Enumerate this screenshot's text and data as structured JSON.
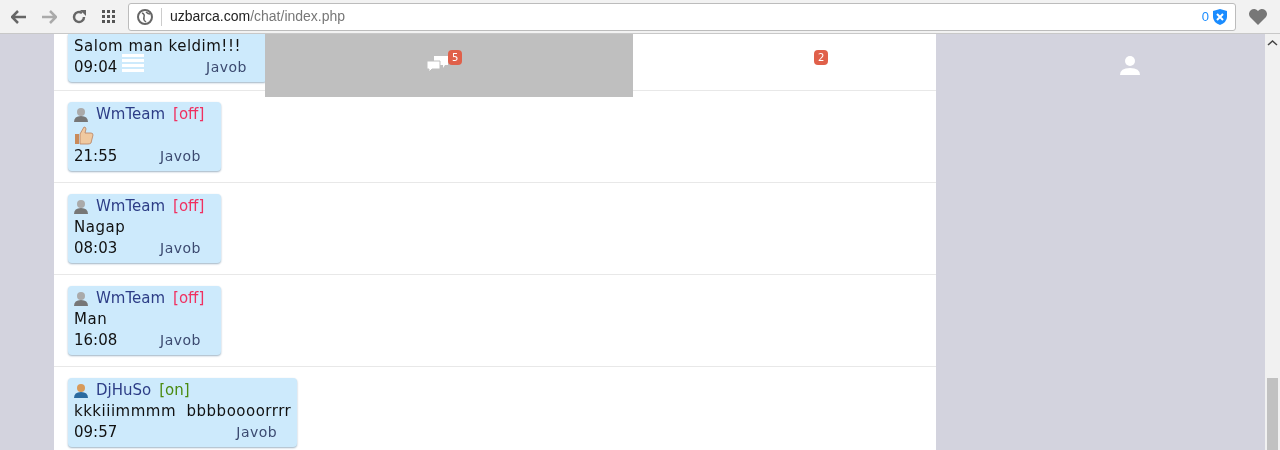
{
  "browser": {
    "url_host": "uzbarca.com",
    "url_path": "/chat/index.php",
    "shield_count": "0"
  },
  "nav": {
    "messages_badge": "5",
    "notifications_badge": "2"
  },
  "messages": [
    {
      "kind": "text",
      "text": "Salom man keldim!!!",
      "time": "09:04",
      "reply": "Javob"
    },
    {
      "kind": "thumbs_up",
      "author": "WmTeam",
      "status": "[off]",
      "online": false,
      "time": "21:55",
      "reply": "Javob"
    },
    {
      "kind": "text",
      "author": "WmTeam",
      "status": "[off]",
      "online": false,
      "text": "Nagap",
      "time": "08:03",
      "reply": "Javob"
    },
    {
      "kind": "text",
      "author": "WmTeam",
      "status": "[off]",
      "online": false,
      "text": "Man",
      "time": "16:08",
      "reply": "Javob"
    },
    {
      "kind": "text",
      "author": "DjHuSo",
      "status": "[on]",
      "online": true,
      "text": "kkkiiimmmm  bbbboooorrrr",
      "time": "09:57",
      "reply": "Javob"
    }
  ]
}
